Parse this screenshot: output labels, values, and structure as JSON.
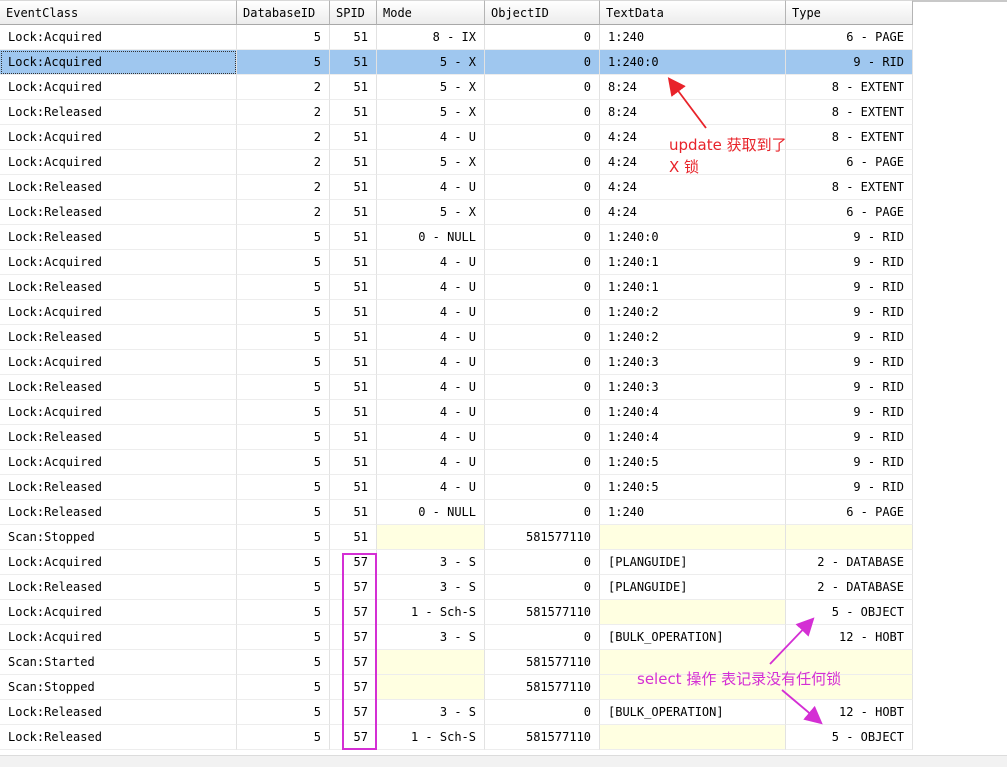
{
  "columns": [
    "EventClass",
    "DatabaseID",
    "SPID",
    "Mode",
    "ObjectID",
    "TextData",
    "Type"
  ],
  "rows": [
    [
      "Lock:Acquired",
      "5",
      "51",
      "8 - IX",
      "0",
      "1:240",
      "6 - PAGE"
    ],
    [
      "Lock:Acquired",
      "5",
      "51",
      "5 - X",
      "0",
      "1:240:0",
      "9 - RID"
    ],
    [
      "Lock:Acquired",
      "2",
      "51",
      "5 - X",
      "0",
      "8:24",
      "8 - EXTENT"
    ],
    [
      "Lock:Released",
      "2",
      "51",
      "5 - X",
      "0",
      "8:24",
      "8 - EXTENT"
    ],
    [
      "Lock:Acquired",
      "2",
      "51",
      "4 - U",
      "0",
      "4:24",
      "8 - EXTENT"
    ],
    [
      "Lock:Acquired",
      "2",
      "51",
      "5 - X",
      "0",
      "4:24",
      "6 - PAGE"
    ],
    [
      "Lock:Released",
      "2",
      "51",
      "4 - U",
      "0",
      "4:24",
      "8 - EXTENT"
    ],
    [
      "Lock:Released",
      "2",
      "51",
      "5 - X",
      "0",
      "4:24",
      "6 - PAGE"
    ],
    [
      "Lock:Released",
      "5",
      "51",
      "0 - NULL",
      "0",
      "1:240:0",
      "9 - RID"
    ],
    [
      "Lock:Acquired",
      "5",
      "51",
      "4 - U",
      "0",
      "1:240:1",
      "9 - RID"
    ],
    [
      "Lock:Released",
      "5",
      "51",
      "4 - U",
      "0",
      "1:240:1",
      "9 - RID"
    ],
    [
      "Lock:Acquired",
      "5",
      "51",
      "4 - U",
      "0",
      "1:240:2",
      "9 - RID"
    ],
    [
      "Lock:Released",
      "5",
      "51",
      "4 - U",
      "0",
      "1:240:2",
      "9 - RID"
    ],
    [
      "Lock:Acquired",
      "5",
      "51",
      "4 - U",
      "0",
      "1:240:3",
      "9 - RID"
    ],
    [
      "Lock:Released",
      "5",
      "51",
      "4 - U",
      "0",
      "1:240:3",
      "9 - RID"
    ],
    [
      "Lock:Acquired",
      "5",
      "51",
      "4 - U",
      "0",
      "1:240:4",
      "9 - RID"
    ],
    [
      "Lock:Released",
      "5",
      "51",
      "4 - U",
      "0",
      "1:240:4",
      "9 - RID"
    ],
    [
      "Lock:Acquired",
      "5",
      "51",
      "4 - U",
      "0",
      "1:240:5",
      "9 - RID"
    ],
    [
      "Lock:Released",
      "5",
      "51",
      "4 - U",
      "0",
      "1:240:5",
      "9 - RID"
    ],
    [
      "Lock:Released",
      "5",
      "51",
      "0 - NULL",
      "0",
      "1:240",
      "6 - PAGE"
    ],
    [
      "Scan:Stopped",
      "5",
      "51",
      "",
      "581577110",
      "",
      ""
    ],
    [
      "Lock:Acquired",
      "5",
      "57",
      "3 - S",
      "0",
      "[PLANGUIDE]",
      "2 - DATABASE"
    ],
    [
      "Lock:Released",
      "5",
      "57",
      "3 - S",
      "0",
      "[PLANGUIDE]",
      "2 - DATABASE"
    ],
    [
      "Lock:Acquired",
      "5",
      "57",
      "1 - Sch-S",
      "581577110",
      "",
      "5 - OBJECT"
    ],
    [
      "Lock:Acquired",
      "5",
      "57",
      "3 - S",
      "0",
      "[BULK_OPERATION]",
      "12 - HOBT"
    ],
    [
      "Scan:Started",
      "5",
      "57",
      "",
      "581577110",
      "",
      ""
    ],
    [
      "Scan:Stopped",
      "5",
      "57",
      "",
      "581577110",
      "",
      ""
    ],
    [
      "Lock:Released",
      "5",
      "57",
      "3 - S",
      "0",
      "[BULK_OPERATION]",
      "12 - HOBT"
    ],
    [
      "Lock:Released",
      "5",
      "57",
      "1 - Sch-S",
      "581577110",
      "",
      "5 - OBJECT"
    ]
  ],
  "selected_row": 1,
  "annotations": {
    "update_note_line1": "update 获取到了",
    "update_note_line2": "X 锁",
    "select_note": "select 操作 表记录没有任何锁"
  },
  "colors": {
    "selection": "#9fc7ef",
    "empty_cell": "#ffffe1",
    "annotation_red": "#e8232a",
    "annotation_magenta": "#d42fd4"
  }
}
